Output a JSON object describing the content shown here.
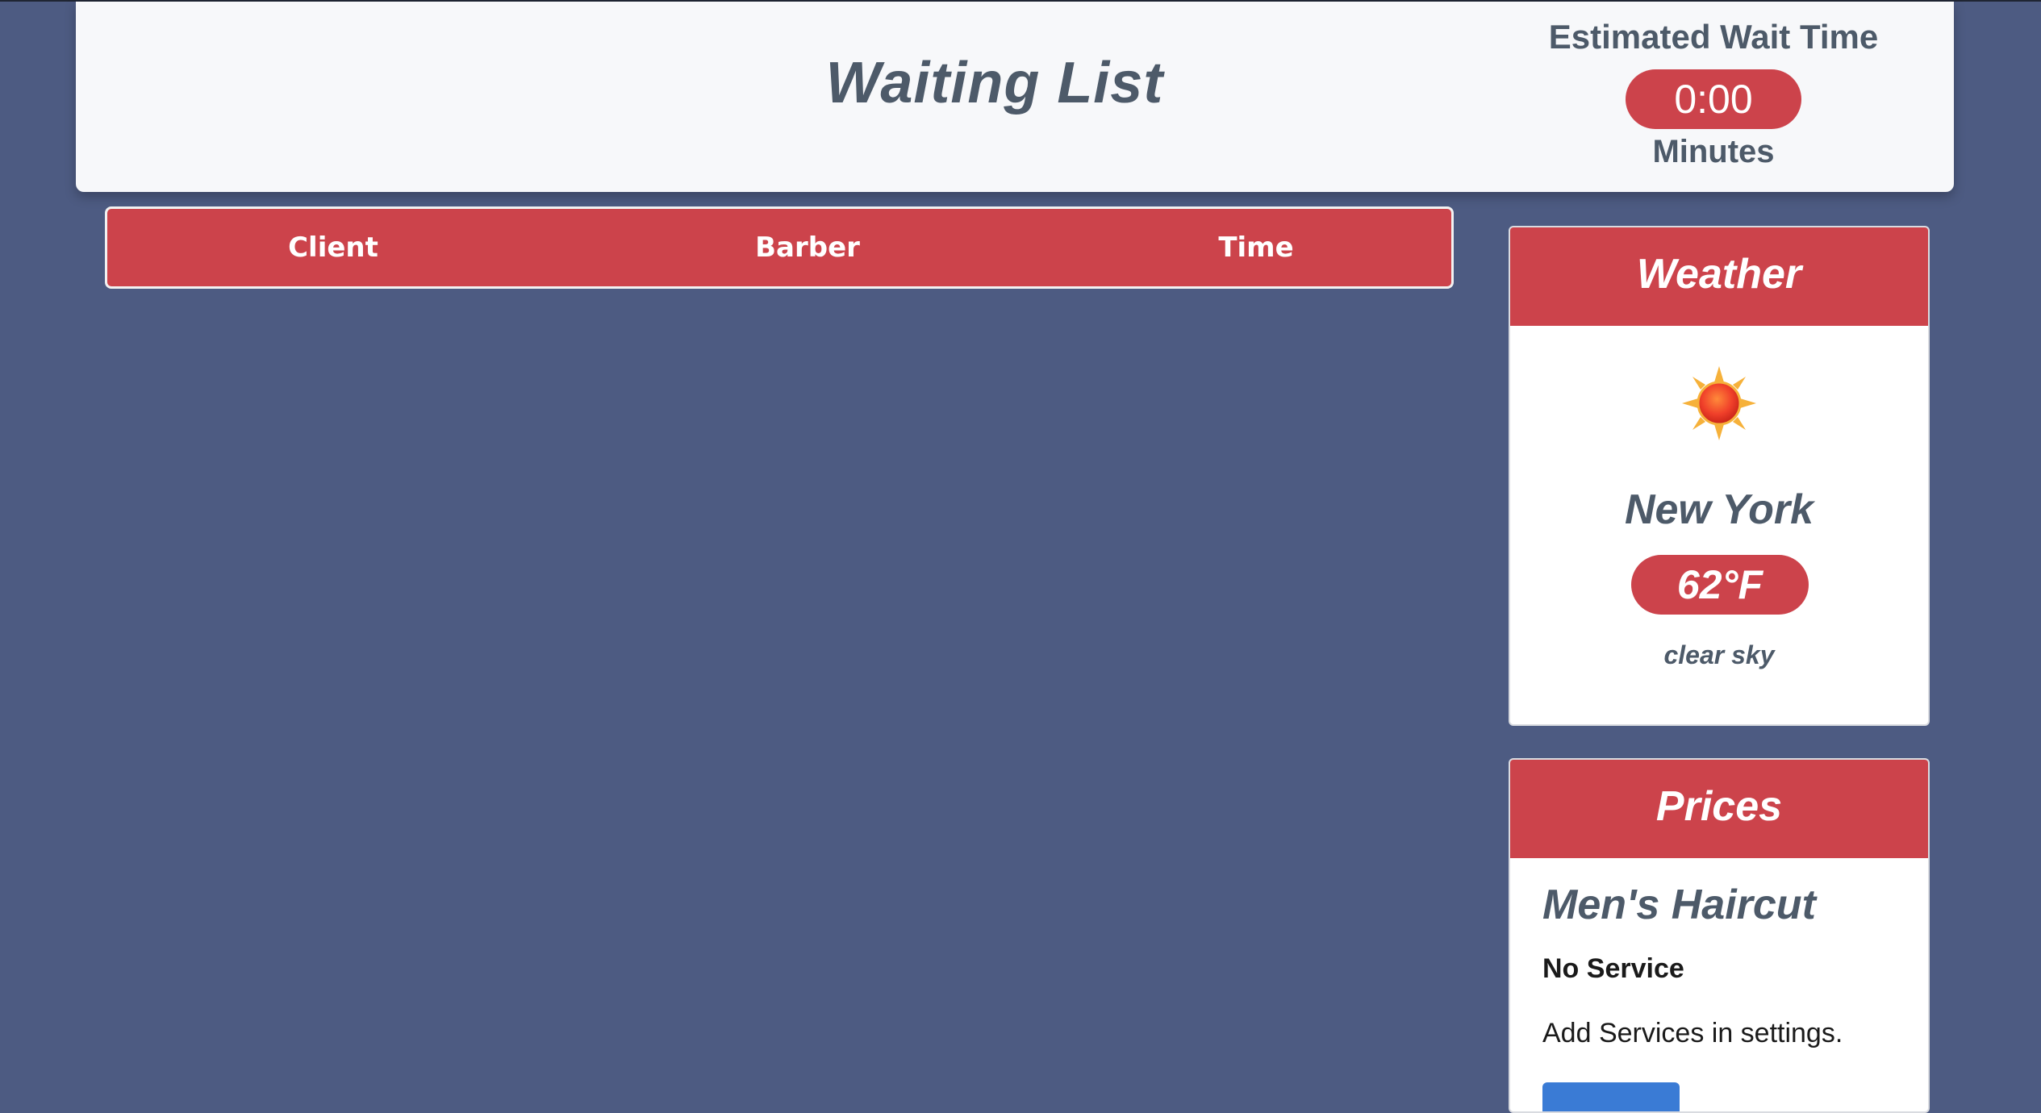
{
  "header": {
    "title": "Waiting List",
    "wait_label": "Estimated Wait Time",
    "wait_value": "0:00",
    "wait_units": "Minutes"
  },
  "table": {
    "columns": [
      "Client",
      "Barber",
      "Time"
    ]
  },
  "weather": {
    "title": "Weather",
    "icon": "sun-icon",
    "city": "New York",
    "temperature": "62°F",
    "description": "clear sky"
  },
  "prices": {
    "title": "Prices",
    "service_title": "Men's Haircut",
    "no_service": "No Service",
    "hint": "Add Services in settings."
  },
  "colors": {
    "background": "#4d5b82",
    "accent": "#cc434b",
    "header_bg": "#f7f8fa",
    "text": "#4d5a69",
    "button": "#3a7bd5"
  }
}
